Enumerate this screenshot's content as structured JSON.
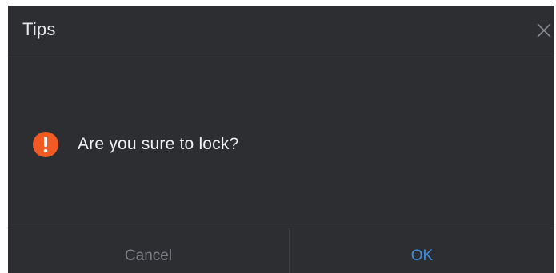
{
  "dialog": {
    "title": "Tips",
    "message": "Are you sure to lock?",
    "icons": {
      "close": "close-icon",
      "message": "warning-icon"
    }
  },
  "buttons": {
    "cancel_label": "Cancel",
    "ok_label": "OK"
  },
  "colors": {
    "background": "#2d2e32",
    "title_text": "#e6e7e9",
    "warning": "#f15a22",
    "ok_text": "#3d8ee6",
    "cancel_text": "#7c7e84"
  }
}
